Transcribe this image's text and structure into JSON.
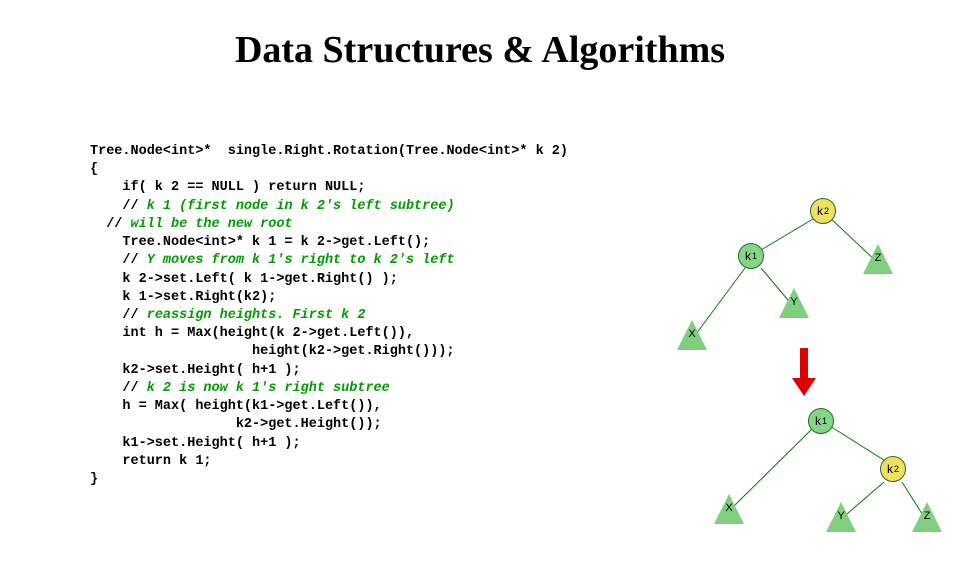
{
  "title": "Data Structures & Algorithms",
  "code": {
    "l0": "Tree.Node<int>*  single.Right.Rotation(Tree.Node<int>* k 2)",
    "l1": "{",
    "l2": "    if( k 2 == NULL ) return NULL;",
    "l3a": "    // ",
    "l3b": "k 1 (first node in k 2's left subtree)",
    "l4a": "  // ",
    "l4b": "will be the new root",
    "l5": "    Tree.Node<int>* k 1 = k 2->get.Left();",
    "l6a": "    // ",
    "l6b": "Y moves from k 1's right to k 2's left",
    "l7": "    k 2->set.Left( k 1->get.Right() );",
    "l8": "    k 1->set.Right(k2);",
    "l9": "",
    "l10a": "    // ",
    "l10b": "reassign heights. First k 2",
    "l11": "    int h = Max(height(k 2->get.Left()),",
    "l12": "                    height(k2->get.Right()));",
    "l13": "    k2->set.Height( h+1 );",
    "l14a": "    // ",
    "l14b": "k 2 is now k 1's right subtree",
    "l15": "    h = Max( height(k1->get.Left()),",
    "l16": "                  k2->get.Height());",
    "l17": "    k1->set.Height( h+1 );",
    "l18": "",
    "l19": "    return k 1;",
    "l20": "}"
  },
  "tree_before": {
    "root": {
      "label": "k",
      "sub": "2",
      "color": "#f0e060"
    },
    "left": {
      "label": "k",
      "sub": "1",
      "color": "#86d486"
    },
    "right": {
      "label": "Z"
    },
    "sub_x": {
      "label": "X"
    },
    "sub_y": {
      "label": "Y"
    }
  },
  "tree_after": {
    "root": {
      "label": "k",
      "sub": "1",
      "color": "#86d486"
    },
    "right": {
      "label": "k",
      "sub": "2",
      "color": "#f0e060"
    },
    "sub_x": {
      "label": "X"
    },
    "sub_y": {
      "label": "Y"
    },
    "sub_z": {
      "label": "Z"
    }
  }
}
